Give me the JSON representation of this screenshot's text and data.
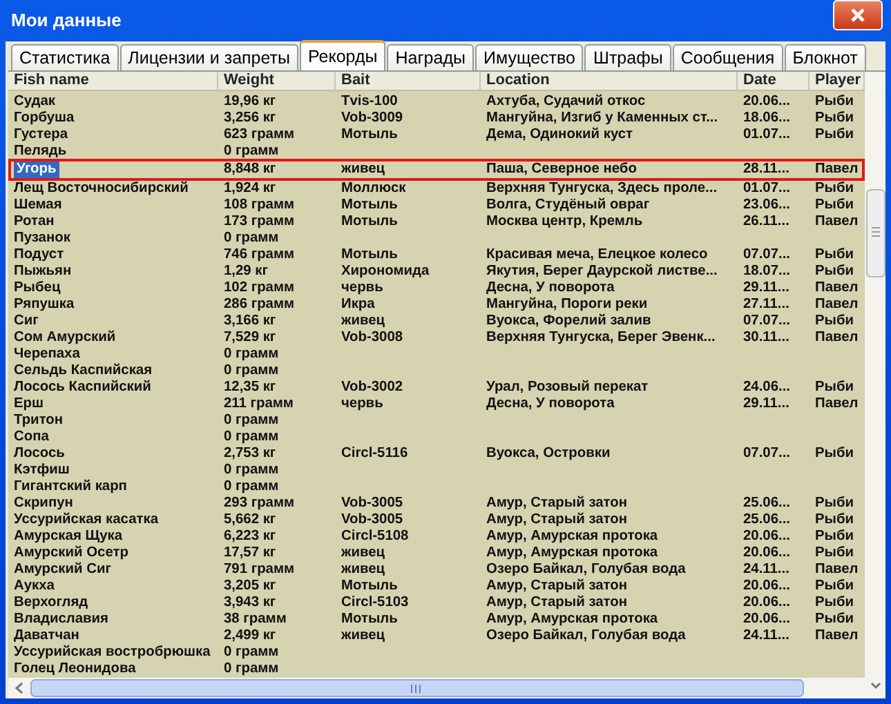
{
  "window": {
    "title": "Мои данные"
  },
  "tabs": [
    {
      "label": "Статистика",
      "selected": false
    },
    {
      "label": "Лицензии и запреты",
      "selected": false
    },
    {
      "label": "Рекорды",
      "selected": true
    },
    {
      "label": "Награды",
      "selected": false
    },
    {
      "label": "Имущество",
      "selected": false
    },
    {
      "label": "Штрафы",
      "selected": false
    },
    {
      "label": "Сообщения",
      "selected": false
    },
    {
      "label": "Блокнот",
      "selected": false
    }
  ],
  "table": {
    "columns": [
      "Fish name",
      "Weight",
      "Bait",
      "Location",
      "Date",
      "Player"
    ],
    "rows": [
      {
        "name": "Судак",
        "weight": "19,96 кг",
        "bait": "Tvis-100",
        "location": "Ахтуба, Судачий откос",
        "date": "20.06...",
        "player": "Рыби",
        "selected": false
      },
      {
        "name": "Горбуша",
        "weight": "3,256 кг",
        "bait": "Vob-3009",
        "location": "Мангуйна, Изгиб у Каменных ст...",
        "date": "18.06...",
        "player": "Рыби",
        "selected": false
      },
      {
        "name": "Густера",
        "weight": "623 грамм",
        "bait": "Мотыль",
        "location": "Дема, Одинокий куст",
        "date": "01.07...",
        "player": "Рыби",
        "selected": false
      },
      {
        "name": "Пелядь",
        "weight": "0 грамм",
        "selected": false
      },
      {
        "name": "Угорь",
        "weight": "8,848 кг",
        "bait": "живец",
        "location": "Паша, Северное небо",
        "date": "28.11...",
        "player": "Павел",
        "selected": true
      },
      {
        "name": "Лещ Восточносибирский",
        "weight": "1,924 кг",
        "bait": "Моллюск",
        "location": "Верхняя Тунгуска, Здесь проле...",
        "date": "01.07...",
        "player": "Рыби",
        "selected": false
      },
      {
        "name": "Шемая",
        "weight": "108 грамм",
        "bait": "Мотыль",
        "location": "Волга, Студёный овраг",
        "date": "23.06...",
        "player": "Рыби",
        "selected": false
      },
      {
        "name": "Ротан",
        "weight": "173 грамм",
        "bait": "Мотыль",
        "location": "Москва центр, Кремль",
        "date": "26.11...",
        "player": "Павел",
        "selected": false
      },
      {
        "name": "Пузанок",
        "weight": "0 грамм",
        "selected": false
      },
      {
        "name": "Подуст",
        "weight": "746 грамм",
        "bait": "Мотыль",
        "location": "Красивая меча, Елецкое колесо",
        "date": "07.07...",
        "player": "Рыби",
        "selected": false
      },
      {
        "name": "Пыжьян",
        "weight": "1,29 кг",
        "bait": "Хирономида",
        "location": "Якутия, Берег Даурской листве...",
        "date": "18.07...",
        "player": "Рыби",
        "selected": false
      },
      {
        "name": "Рыбец",
        "weight": "102 грамм",
        "bait": "червь",
        "location": "Десна, У поворота",
        "date": "29.11...",
        "player": "Павел",
        "selected": false
      },
      {
        "name": "Ряпушка",
        "weight": "286 грамм",
        "bait": "Икра",
        "location": "Мангуйна, Пороги реки",
        "date": "27.11...",
        "player": "Павел",
        "selected": false
      },
      {
        "name": "Сиг",
        "weight": "3,166 кг",
        "bait": "живец",
        "location": "Вуокса, Форелий залив",
        "date": "07.07...",
        "player": "Рыби",
        "selected": false
      },
      {
        "name": "Сом Амурский",
        "weight": "7,529 кг",
        "bait": "Vob-3008",
        "location": "Верхняя Тунгуска, Берег Эвенк...",
        "date": "30.11...",
        "player": "Павел",
        "selected": false
      },
      {
        "name": "Черепаха",
        "weight": "0 грамм",
        "selected": false
      },
      {
        "name": "Сельдь Каспийская",
        "weight": "0 грамм",
        "selected": false
      },
      {
        "name": "Лосось Каспийский",
        "weight": "12,35 кг",
        "bait": "Vob-3002",
        "location": "Урал, Розовый перекат",
        "date": "24.06...",
        "player": "Рыби",
        "selected": false
      },
      {
        "name": "Ерш",
        "weight": "211 грамм",
        "bait": "червь",
        "location": "Десна, У поворота",
        "date": "29.11...",
        "player": "Павел",
        "selected": false
      },
      {
        "name": "Тритон",
        "weight": "0 грамм",
        "selected": false
      },
      {
        "name": "Сопа",
        "weight": "0 грамм",
        "selected": false
      },
      {
        "name": "Лосось",
        "weight": "2,753 кг",
        "bait": "Circl-5116",
        "location": "Вуокса, Островки",
        "date": "07.07...",
        "player": "Рыби",
        "selected": false
      },
      {
        "name": "Кэтфиш",
        "weight": "0 грамм",
        "selected": false
      },
      {
        "name": "Гигантский карп",
        "weight": "0 грамм",
        "selected": false
      },
      {
        "name": "Скрипун",
        "weight": "293 грамм",
        "bait": "Vob-3005",
        "location": "Амур, Старый затон",
        "date": "25.06...",
        "player": "Рыби",
        "selected": false
      },
      {
        "name": "Уссурийская касатка",
        "weight": "5,662 кг",
        "bait": "Vob-3005",
        "location": "Амур, Старый затон",
        "date": "25.06...",
        "player": "Рыби",
        "selected": false
      },
      {
        "name": "Амурская Щука",
        "weight": "6,223 кг",
        "bait": "Circl-5108",
        "location": "Амур, Амурская протока",
        "date": "20.06...",
        "player": "Рыби",
        "selected": false
      },
      {
        "name": "Амурский Осетр",
        "weight": "17,57 кг",
        "bait": "живец",
        "location": "Амур, Амурская протока",
        "date": "20.06...",
        "player": "Рыби",
        "selected": false
      },
      {
        "name": "Амурский Сиг",
        "weight": "791 грамм",
        "bait": "живец",
        "location": "Озеро Байкал, Голубая вода",
        "date": "24.11...",
        "player": "Павел",
        "selected": false
      },
      {
        "name": "Аукха",
        "weight": "3,205 кг",
        "bait": "Мотыль",
        "location": "Амур, Старый затон",
        "date": "20.06...",
        "player": "Рыби",
        "selected": false
      },
      {
        "name": "Верхогляд",
        "weight": "3,943 кг",
        "bait": "Circl-5103",
        "location": "Амур, Старый затон",
        "date": "20.06...",
        "player": "Рыби",
        "selected": false
      },
      {
        "name": "Владиславия",
        "weight": "38 грамм",
        "bait": "Мотыль",
        "location": "Амур, Амурская протока",
        "date": "20.06...",
        "player": "Рыби",
        "selected": false
      },
      {
        "name": "Даватчан",
        "weight": "2,499 кг",
        "bait": "живец",
        "location": "Озеро Байкал, Голубая вода",
        "date": "24.11...",
        "player": "Павел",
        "selected": false
      },
      {
        "name": "Уссурийская востробрюшка",
        "weight": "0 грамм",
        "selected": false
      },
      {
        "name": "Голец Леонидова",
        "weight": "0 грамм",
        "selected": false
      }
    ]
  }
}
